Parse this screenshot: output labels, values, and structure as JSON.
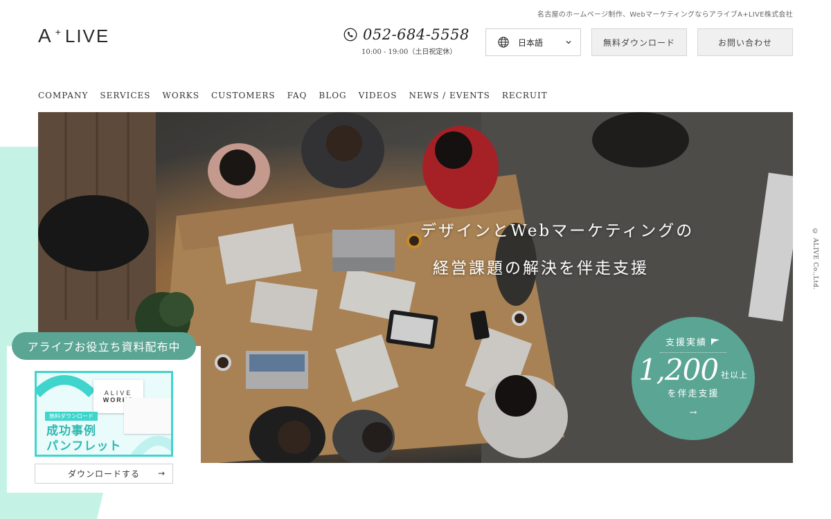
{
  "header": {
    "tagline": "名古屋のホームページ制作、WebマーケティングならアライブA+LIVE株式会社",
    "logo": {
      "a": "A",
      "plus": "+",
      "live": "LIVE"
    },
    "phone": {
      "number": "052-684-5558",
      "hours": "10:00 - 19:00（土日祝定休）",
      "icon": "phone-icon"
    },
    "language": {
      "selected": "日本語",
      "icon": "globe-icon"
    },
    "download_label": "無料ダウンロード",
    "contact_label": "お問い合わせ"
  },
  "nav": {
    "items": [
      "COMPANY",
      "SERVICES",
      "WORKS",
      "CUSTOMERS",
      "FAQ",
      "BLOG",
      "VIDEOS",
      "NEWS / EVENTS",
      "RECRUIT"
    ]
  },
  "hero": {
    "line1": "デザインとWebマーケティングの",
    "line2": "経営課題の解決を伴走支援",
    "badge": {
      "title": "支援実績",
      "number": "1,200",
      "suffix": "社以上",
      "sub": "を伴走支援",
      "arrow": "→"
    }
  },
  "promo": {
    "pill": "アライブお役立ち資料配布中",
    "brochure_line1": "ALIVE",
    "brochure_line2": "WORKS",
    "tag": "無料ダウンロード",
    "title1": "成功事例",
    "title2": "パンフレット",
    "download_label": "ダウンロードする",
    "download_arrow": "→"
  },
  "copyright": "© ALIVE Co.,Ltd.",
  "colors": {
    "accent": "#5aa594",
    "mint": "#c4f3e5",
    "promo_cyan": "#3fd4cc"
  }
}
